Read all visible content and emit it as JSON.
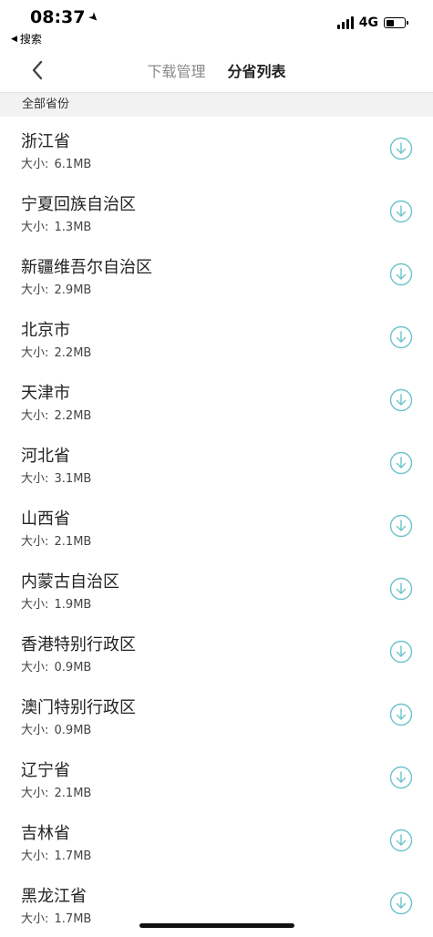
{
  "status_bar": {
    "time": "08:37",
    "back_app_label": "搜索",
    "network": "4G"
  },
  "nav": {
    "tabs": [
      {
        "label": "下载管理",
        "active": false
      },
      {
        "label": "分省列表",
        "active": true
      }
    ]
  },
  "section": {
    "title": "全部省份"
  },
  "size_prefix": "大小: ",
  "provinces": [
    {
      "name": "浙江省",
      "size": "6.1MB"
    },
    {
      "name": "宁夏回族自治区",
      "size": "1.3MB"
    },
    {
      "name": "新疆维吾尔自治区",
      "size": "2.9MB"
    },
    {
      "name": "北京市",
      "size": "2.2MB"
    },
    {
      "name": "天津市",
      "size": "2.2MB"
    },
    {
      "name": "河北省",
      "size": "3.1MB"
    },
    {
      "name": "山西省",
      "size": "2.1MB"
    },
    {
      "name": "内蒙古自治区",
      "size": "1.9MB"
    },
    {
      "name": "香港特别行政区",
      "size": "0.9MB"
    },
    {
      "name": "澳门特别行政区",
      "size": "0.9MB"
    },
    {
      "name": "辽宁省",
      "size": "2.1MB"
    },
    {
      "name": "吉林省",
      "size": "1.7MB"
    },
    {
      "name": "黑龙江省",
      "size": "1.7MB"
    }
  ],
  "colors": {
    "download_icon": "#6cc3c9",
    "section_bg": "#f2f2f2",
    "tab_inactive": "#8a8a8a"
  },
  "icons": {
    "download": "download-circle-icon",
    "back": "chevron-left-icon",
    "location": "location-arrow-icon"
  }
}
